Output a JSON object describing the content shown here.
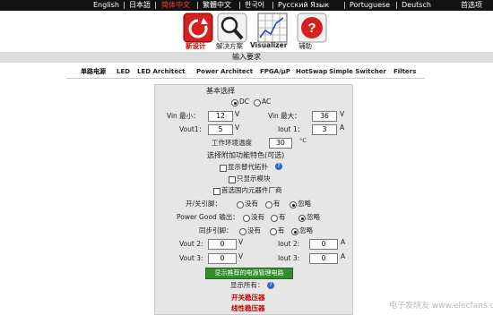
{
  "languages": [
    "English",
    "日本語",
    "简体中文",
    "繁體中文",
    "한국어",
    "Русский Язык",
    "Portuguese",
    "Deutsch"
  ],
  "language_separator": "|",
  "top_right": "首选项",
  "toolbar": {
    "new_design": "新设计",
    "solutions": "解决方案",
    "visualizer": "Visualizer",
    "help": "辅助"
  },
  "section_title": "输入要求",
  "tabs": [
    "单路电源",
    "LED",
    "LED Architect",
    "Power Architect",
    "FPGA/μP",
    "HotSwap",
    "Simple Switcher",
    "Filters"
  ],
  "form": {
    "basic_title": "基本选择",
    "dc_label": "DC",
    "ac_label": "AC",
    "vin_min_label": "Vin 最小：",
    "vin_min_value": "12",
    "vin_max_label": "Vin 最大：",
    "vin_max_value": "36",
    "vout1_label": "Vout1：",
    "vout1_value": "5",
    "iout1_label": "Iout 1：",
    "iout1_value": "3",
    "unit_v": "V",
    "unit_a": "A",
    "temp_label": "工作环境温度",
    "temp_value": "30",
    "temp_unit": "°C",
    "optional_title": "选择附加功能特色(可选)",
    "opt_alt_topology": "显示替代拓扑",
    "opt_modules_only": "只显示模块",
    "opt_domestic": "首选国内元器件厂商",
    "onoff_label": "开/关引脚：",
    "pgood_label": "Power Good 输出：",
    "sync_label": "同步引脚：",
    "none": "没有",
    "have": "有",
    "ignore": "忽略",
    "vout2_label": "Vout 2:",
    "vout2_value": "0",
    "iout2_label": "Iout 2:",
    "iout2_value": "0",
    "vout3_label": "Vout 3:",
    "vout3_value": "0",
    "iout3_label": "Iout 3:",
    "iout3_value": "0",
    "show_button": "显示推荐的电源管理电路",
    "show_all_label": "显示所有：",
    "switch_regulator": "开关稳压器",
    "linear_regulator": "线性稳压器",
    "help_mark": "?"
  },
  "watermark": "电子发烧友 www.elecfans.com",
  "colors": {
    "top_bar": "#121212",
    "active_language": "#ff3b30",
    "button_green": "#2f8f2f",
    "link_red": "#c00000",
    "help_blue": "#2d68c4"
  }
}
